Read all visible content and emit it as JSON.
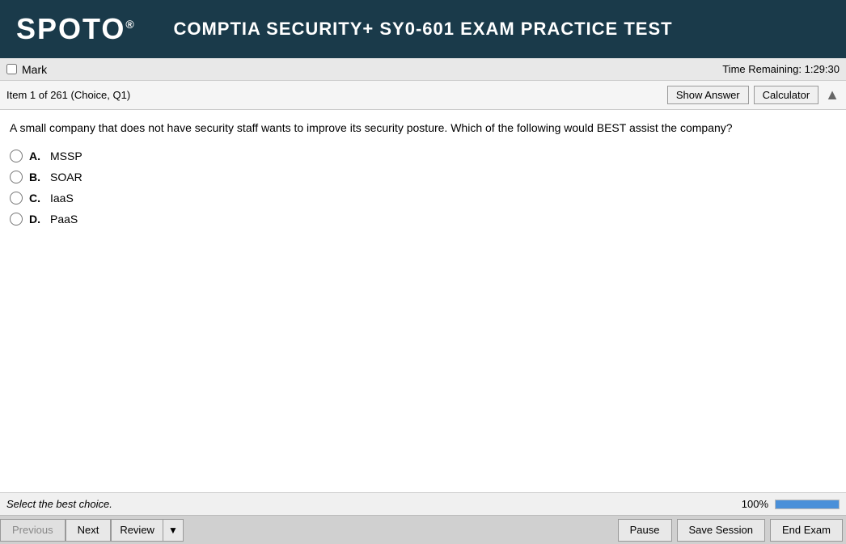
{
  "header": {
    "logo": "SPOTO",
    "logo_sup": "®",
    "title": "COMPTIA SECURITY+ SY0-601 EXAM PRACTICE TEST"
  },
  "mark_bar": {
    "mark_label": "Mark",
    "time_label": "Time Remaining:",
    "time_value": "1:29:30"
  },
  "item_bar": {
    "item_info": "Item 1 of 261 (Choice, Q1)",
    "show_answer_label": "Show Answer",
    "calculator_label": "Calculator"
  },
  "question": {
    "text": "A small company that does not have security staff wants to improve its security posture. Which of the following would BEST assist the company?",
    "options": [
      {
        "letter": "A.",
        "text": "MSSP"
      },
      {
        "letter": "B.",
        "text": "SOAR"
      },
      {
        "letter": "C.",
        "text": "IaaS"
      },
      {
        "letter": "D.",
        "text": "PaaS"
      }
    ]
  },
  "status_bar": {
    "text": "Select the best choice.",
    "progress_percent": "100%",
    "progress_value": 100
  },
  "bottom_bar": {
    "previous_label": "Previous",
    "next_label": "Next",
    "review_label": "Review",
    "pause_label": "Pause",
    "save_session_label": "Save Session",
    "end_exam_label": "End Exam"
  }
}
